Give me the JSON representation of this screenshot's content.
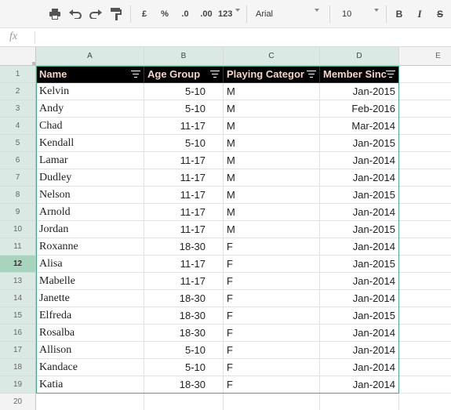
{
  "toolbar": {
    "currency": "£",
    "percent": "%",
    "decrease_decimals": ".0",
    "increase_decimals": ".00",
    "more_formats": "123",
    "font_name": "Arial",
    "font_size": "10",
    "bold": "B",
    "italic": "I",
    "strikethrough": "S"
  },
  "formula_bar": {
    "label": "fx",
    "value": ""
  },
  "columns": [
    "A",
    "B",
    "C",
    "D",
    "E"
  ],
  "row_numbers": [
    "1",
    "2",
    "3",
    "4",
    "5",
    "6",
    "7",
    "8",
    "9",
    "10",
    "11",
    "12",
    "13",
    "14",
    "15",
    "16",
    "17",
    "18",
    "19",
    "20"
  ],
  "headers": [
    "Name",
    "Age Group",
    "Playing Categor",
    "Member Sinc"
  ],
  "rows": [
    [
      "Kelvin",
      "5-10",
      "M",
      "Jan-2015"
    ],
    [
      "Andy",
      "5-10",
      "M",
      "Feb-2016"
    ],
    [
      "Chad",
      "11-17",
      "M",
      "Mar-2014"
    ],
    [
      "Kendall",
      "5-10",
      "M",
      "Jan-2015"
    ],
    [
      "Lamar",
      "11-17",
      "M",
      "Jan-2014"
    ],
    [
      "Dudley",
      "11-17",
      "M",
      "Jan-2014"
    ],
    [
      "Nelson",
      "11-17",
      "M",
      "Jan-2015"
    ],
    [
      "Arnold",
      "11-17",
      "M",
      "Jan-2014"
    ],
    [
      "Jordan",
      "11-17",
      "M",
      "Jan-2015"
    ],
    [
      "Roxanne",
      "18-30",
      "F",
      "Jan-2014"
    ],
    [
      "Alisa",
      "11-17",
      "F",
      "Jan-2015"
    ],
    [
      "Mabelle",
      "11-17",
      "F",
      "Jan-2014"
    ],
    [
      "Janette",
      "18-30",
      "F",
      "Jan-2014"
    ],
    [
      "Elfreda",
      "18-30",
      "F",
      "Jan-2015"
    ],
    [
      "Rosalba",
      "18-30",
      "F",
      "Jan-2014"
    ],
    [
      "Allison",
      "5-10",
      "F",
      "Jan-2014"
    ],
    [
      "Kandace",
      "5-10",
      "F",
      "Jan-2014"
    ],
    [
      "Katia",
      "18-30",
      "F",
      "Jan-2014"
    ]
  ],
  "active_row": "12",
  "colors": {
    "header_bg": "#000000",
    "header_text": "#f6d4c8",
    "selection": "#4aa784"
  }
}
